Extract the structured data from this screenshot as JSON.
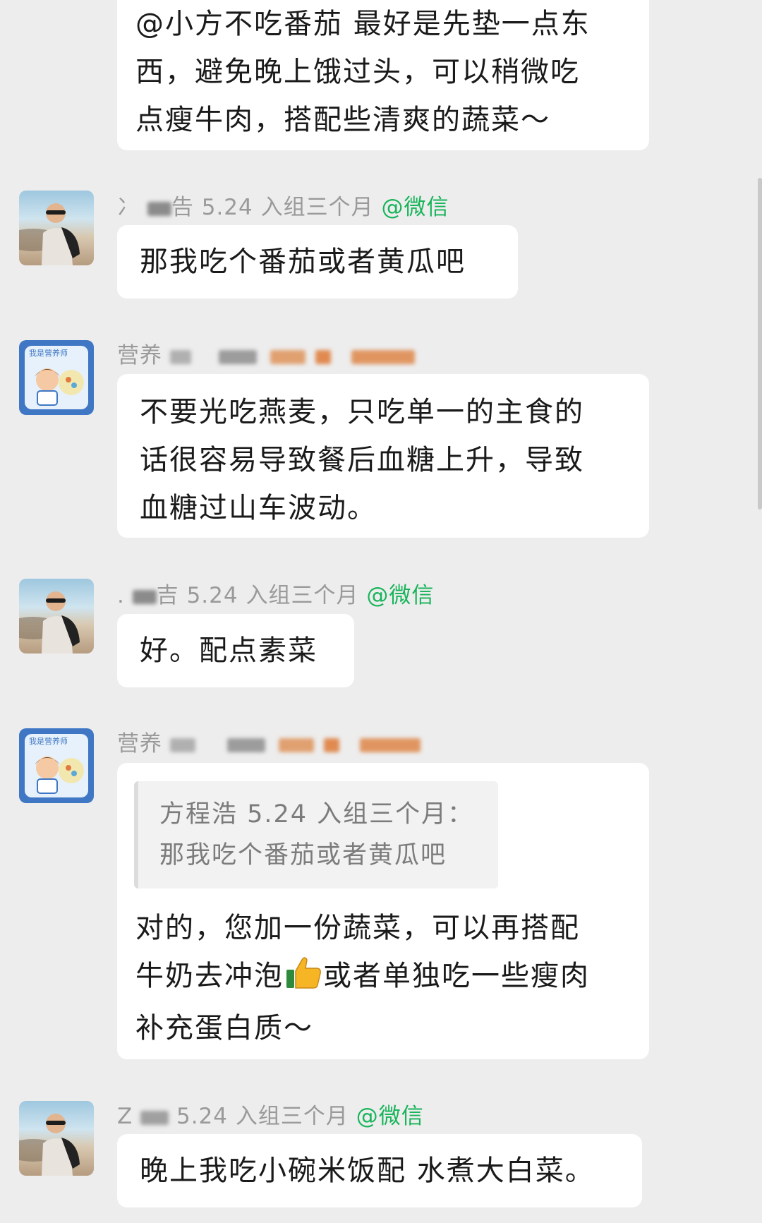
{
  "messages": [
    {
      "text": "@小方不吃番茄 最好是先垫一点东\n西，避免晚上饿过头，可以稍微吃\n点瘦牛肉，搭配些清爽的蔬菜～"
    },
    {
      "sender": "5.24 入组三个月",
      "sender_prefix_visible": "冫",
      "sender_suffix_visible": "告",
      "tag": "@微信",
      "text": "那我吃个番茄或者黄瓜吧"
    },
    {
      "sender": "营养",
      "text": "不要光吃燕麦，只吃单一的主食的\n话很容易导致餐后血糖上升，导致\n血糖过山车波动。"
    },
    {
      "sender": "5.24 入组三个月",
      "sender_prefix_visible": ".",
      "sender_suffix_visible": "吉",
      "tag": "@微信",
      "text": "好。配点素菜"
    },
    {
      "sender": "营养",
      "quote": {
        "line1": "方程浩 5.24 入组三个月：",
        "line2": "那我吃个番茄或者黄瓜吧"
      },
      "text_part1": "对的，您加一份蔬菜，可以再搭配\n牛奶去冲泡",
      "text_part2": "或者单独吃一些瘦肉\n补充蛋白质～"
    },
    {
      "sender": "5.24 入组三个月",
      "sender_prefix_visible": "Z",
      "tag": "@微信",
      "text": "晚上我吃小碗米饭配 水煮大白菜。"
    }
  ],
  "icons": {
    "user_avatar": "user-avatar-photo",
    "nutritionist_avatar": "nutritionist-avatar-illustration",
    "thumbs_up": "thumbs-up-emoji"
  },
  "colors": {
    "background": "#ededed",
    "bubble": "#ffffff",
    "wechat_tag": "#17b45a",
    "sender_text": "#9a9a9a",
    "nutritionist_avatar_bg": "#3f77c4"
  }
}
